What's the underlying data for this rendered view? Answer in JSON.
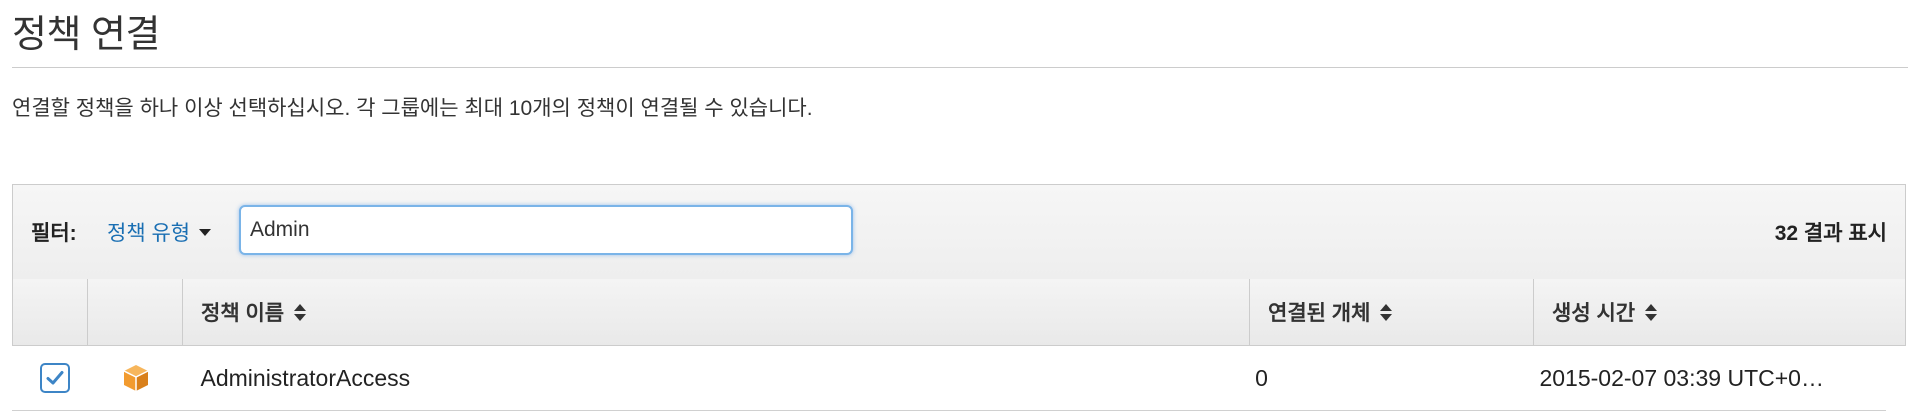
{
  "page": {
    "title": "정책 연결",
    "description": "연결할 정책을 하나 이상 선택하십시오. 각 그룹에는 최대 10개의 정책이 연결될 수 있습니다."
  },
  "filter": {
    "label": "필터:",
    "policy_type_label": "정책 유형",
    "search_value": "Admin",
    "result_count": "32 결과 표시"
  },
  "table": {
    "columns": {
      "name": "정책 이름",
      "attached": "연결된 개체",
      "created": "생성 시간"
    },
    "rows": [
      {
        "checked": true,
        "icon": "aws-managed-policy-cube-icon",
        "name": "AdministratorAccess",
        "attached": "0",
        "created": "2015-02-07 03:39 UTC+0…"
      }
    ]
  },
  "colors": {
    "link": "#1a6fb3",
    "focus_border": "#7ab4e8",
    "checkbox": "#3d85c6",
    "policy_icon": "#f29b2f"
  }
}
